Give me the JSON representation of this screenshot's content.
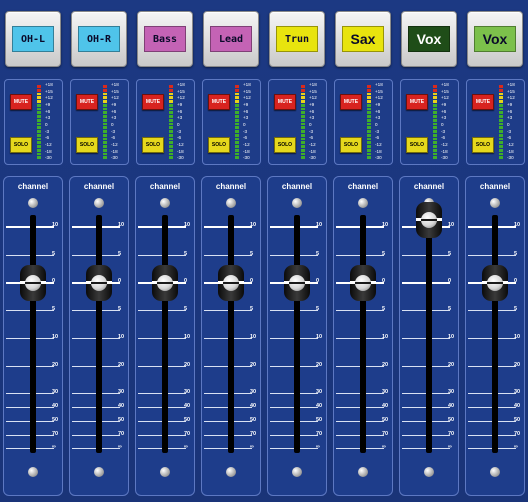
{
  "channels": [
    {
      "label": "OH-L",
      "color": "#4fc4ea",
      "font": "mono",
      "fader_db": 0
    },
    {
      "label": "OH-R",
      "color": "#4fc4ea",
      "font": "mono",
      "fader_db": 0
    },
    {
      "label": "Bass",
      "color": "#c463b5",
      "font": "mono",
      "fader_db": 0
    },
    {
      "label": "Lead",
      "color": "#c463b5",
      "font": "mono",
      "fader_db": 0
    },
    {
      "label": "Trun",
      "color": "#e8e40e",
      "font": "mono",
      "fader_db": 0
    },
    {
      "label": "Sax",
      "color": "#e8e40e",
      "font": "sans",
      "fader_db": 0
    },
    {
      "label": "Vox",
      "color": "#1f4d18",
      "font": "sans",
      "text_color": "#ffffff",
      "fader_db": 10
    },
    {
      "label": "Vox",
      "color": "#7cc04b",
      "font": "sans",
      "fader_db": 0
    }
  ],
  "buttons": {
    "mute": "MUTE",
    "solo": "SOLO"
  },
  "strip_title": "channel",
  "meter_scale": [
    "+18",
    "+15",
    "+12",
    "+9",
    "+6",
    "+3",
    "0",
    "-3",
    "-6",
    "-12",
    "-18",
    "-30"
  ],
  "fader_scale": [
    "10",
    "5",
    "0",
    "5",
    "10",
    "20",
    "30",
    "40",
    "50",
    "70",
    "∞"
  ],
  "colors": {
    "background": "#1c3983",
    "mute": "#d8231f",
    "solo": "#e6d81c",
    "meter_green": "#3fae2a",
    "meter_yellow": "#e8d21a",
    "meter_red": "#d92a1c"
  }
}
